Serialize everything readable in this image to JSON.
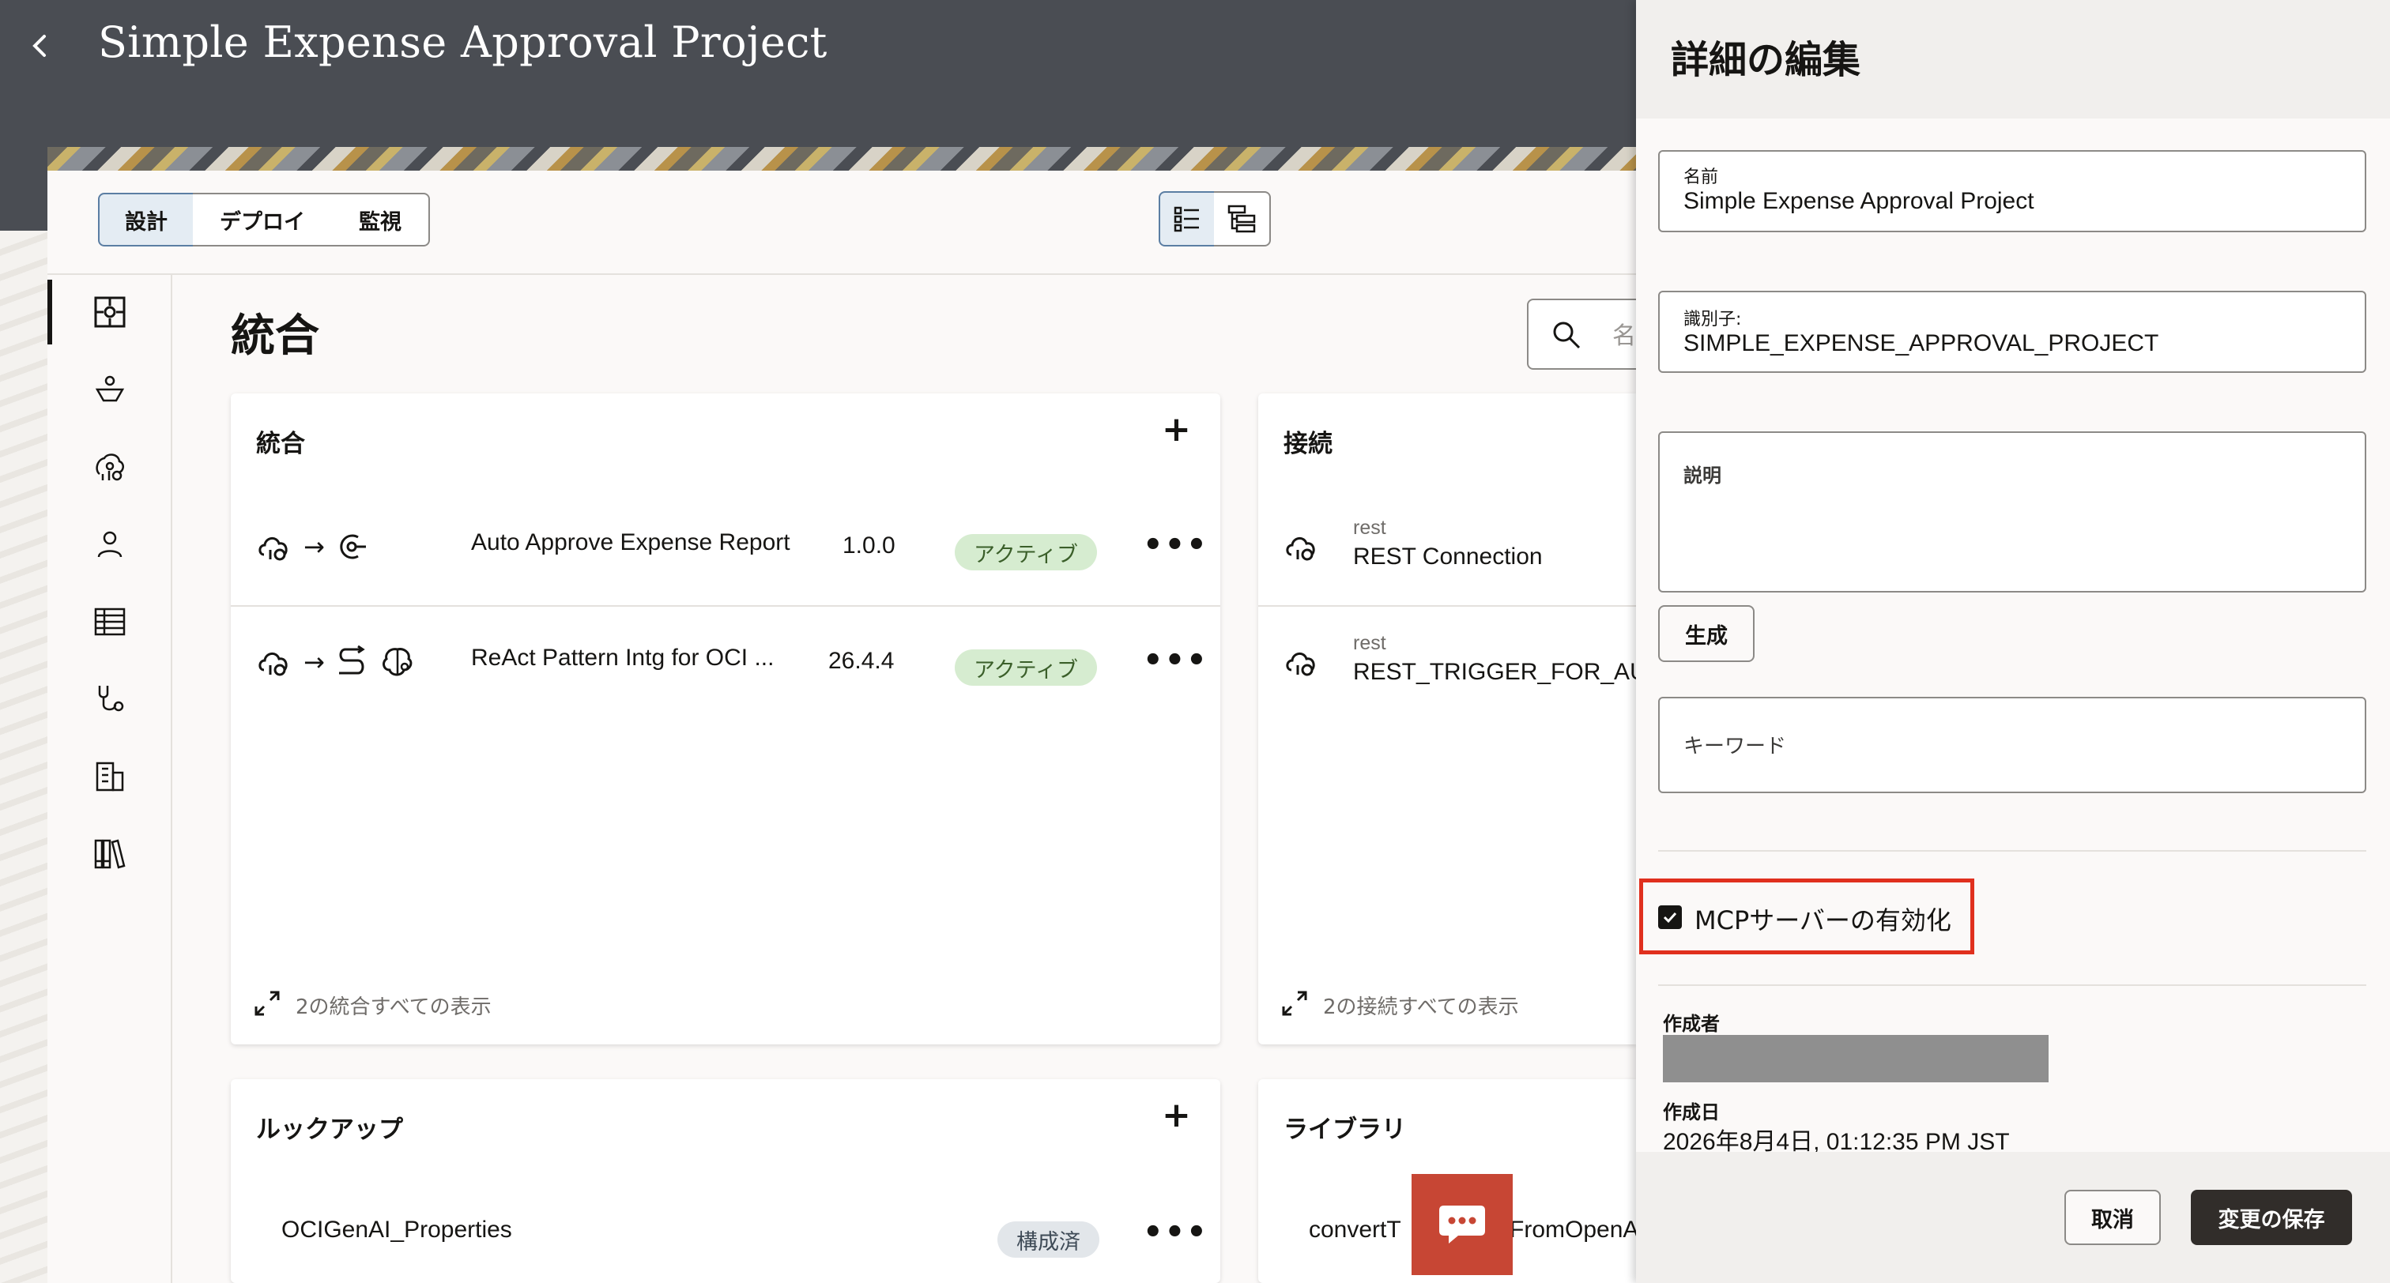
{
  "header": {
    "title": "Simple Expense Approval Project"
  },
  "tabs": [
    {
      "label": "設計",
      "active": true
    },
    {
      "label": "デプロイ",
      "active": false
    },
    {
      "label": "監視",
      "active": false
    }
  ],
  "main": {
    "section_title": "統合",
    "search_placeholder": "名"
  },
  "cards": {
    "integrations": {
      "title": "統合",
      "rows": [
        {
          "name": "Auto Approve Expense Report",
          "version": "1.0.0",
          "status": "アクティブ"
        },
        {
          "name": "ReAct Pattern Intg for OCI ...",
          "version": "26.4.4",
          "status": "アクティブ"
        }
      ],
      "footer": "2の統合すべての表示"
    },
    "connections": {
      "title": "接続",
      "rows": [
        {
          "type": "rest",
          "name": "REST Connection"
        },
        {
          "type": "rest",
          "name": "REST_TRIGGER_FOR_AU"
        }
      ],
      "footer": "2の接続すべての表示"
    },
    "lookups": {
      "title": "ルックアップ",
      "rows": [
        {
          "name": "OCIGenAI_Properties",
          "status": "構成済"
        }
      ]
    },
    "libraries": {
      "title": "ライブラリ",
      "rows": [
        {
          "name_left": "convertT",
          "name_right": "FromOpenA"
        }
      ]
    }
  },
  "drawer": {
    "title": "詳細の編集",
    "name_label": "名前",
    "name_value": "Simple Expense Approval Project",
    "id_label": "識別子:",
    "id_value": "SIMPLE_EXPENSE_APPROVAL_PROJECT",
    "desc_label": "説明",
    "generate_label": "生成",
    "keyword_placeholder": "キーワード",
    "mcp_label": "MCPサーバーの有効化",
    "mcp_checked": true,
    "creator_label": "作成者",
    "created_label": "作成日",
    "created_value": "2026年8月4日, 01:12:35 PM JST",
    "cancel_label": "取消",
    "save_label": "変更の保存"
  },
  "colors": {
    "header_bg": "#4a4d53",
    "active_badge_bg": "#d6ecd0",
    "highlight": "#e0301e",
    "chat_button": "#c74634",
    "save_button": "#312d2a"
  }
}
